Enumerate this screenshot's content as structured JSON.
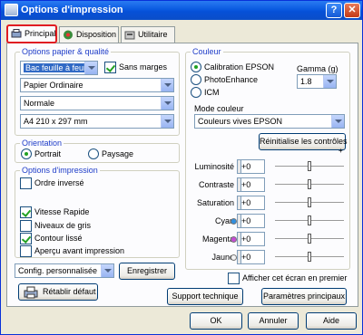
{
  "window": {
    "title": "Options d'impression",
    "help_glyph": "?",
    "close_glyph": "✕",
    "icon": "printer-icon"
  },
  "tabs": [
    {
      "label": "Principal",
      "icon": "principal-tab-icon",
      "active": true
    },
    {
      "label": "Disposition",
      "icon": "disposition-tab-icon",
      "active": false
    },
    {
      "label": "Utilitaire",
      "icon": "utilitaire-tab-icon",
      "active": false
    }
  ],
  "paper": {
    "group_label": "Options papier & qualité",
    "source": "Bac feuille à feuille",
    "borderless_label": "Sans marges",
    "borderless_checked": true,
    "media_type": "Papier Ordinaire",
    "quality": "Normale",
    "size": "A4 210 x 297 mm"
  },
  "orientation": {
    "group_label": "Orientation",
    "portrait_label": "Portrait",
    "landscape_label": "Paysage",
    "selected": "portrait"
  },
  "print_options": {
    "group_label": "Options d'impression",
    "reverse_order_label": "Ordre inversé",
    "reverse_order_checked": false,
    "high_speed_label": "Vitesse Rapide",
    "high_speed_checked": true,
    "grayscale_label": "Niveaux de gris",
    "grayscale_checked": false,
    "edge_smoothing_label": "Contour lissé",
    "edge_smoothing_checked": true,
    "preview_label": "Aperçu avant impression",
    "preview_checked": false
  },
  "custom_settings": {
    "value": "Config. personnalisée",
    "save_label": "Enregistrer",
    "reset_label": "Rétablir défaut"
  },
  "color": {
    "group_label": "Couleur",
    "epson_calibration_label": "Calibration EPSON",
    "photo_enhance_label": "PhotoEnhance",
    "icm_label": "ICM",
    "selected": "epson_calibration",
    "gamma_label": "Gamma (g)",
    "gamma_value": "1.8",
    "mode_label": "Mode couleur",
    "mode_value": "Couleurs vives EPSON",
    "reset_controls_label": "Réinitialise les contrôles"
  },
  "adjustments": [
    {
      "label": "Luminosité",
      "value": "+0",
      "level": 0.5,
      "dot": ""
    },
    {
      "label": "Contraste",
      "value": "+0",
      "level": 0.5,
      "dot": ""
    },
    {
      "label": "Saturation",
      "value": "+0",
      "level": 0.5,
      "dot": ""
    },
    {
      "label": "Cyan",
      "value": "+0",
      "level": 0.5,
      "dot": "#2f8fe0"
    },
    {
      "label": "Magenta",
      "value": "+0",
      "level": 0.5,
      "dot": "#c64bd6"
    },
    {
      "label": "Jaune",
      "value": "+0",
      "level": 0.5,
      "dot": "#f3f3f3"
    }
  ],
  "slider_plus_glyph": "+",
  "show_screen_first_label": "Afficher cet écran en premier",
  "show_screen_first_checked": false,
  "tech_support_label": "Support technique",
  "main_settings_label": "Paramètres principaux",
  "footer": {
    "ok": "OK",
    "cancel": "Annuler",
    "help": "Aide"
  }
}
